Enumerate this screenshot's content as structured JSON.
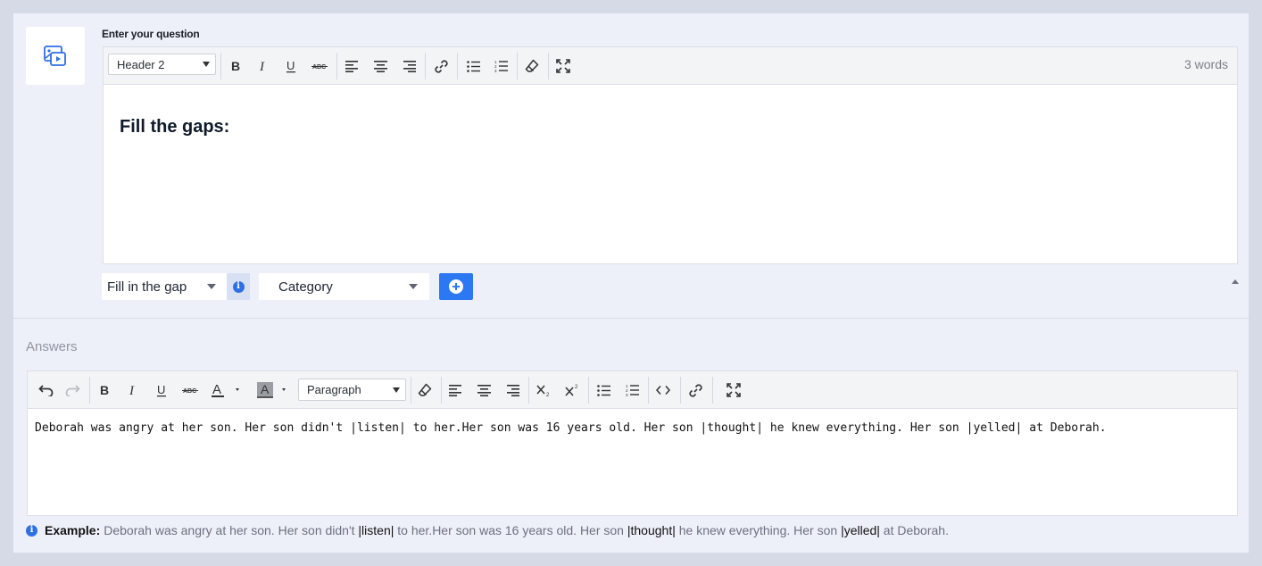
{
  "question": {
    "label": "Enter your question",
    "editor": {
      "block_format": "Header 2",
      "word_count": "3 words",
      "content": "Fill the gaps:"
    },
    "type_select": "Fill in the gap",
    "category_select": "Category"
  },
  "answers": {
    "label": "Answers",
    "editor": {
      "block_format": "Paragraph",
      "content": "Deborah was angry at her son. Her son didn't |listen| to her.Her son was 16 years old. Her son |thought| he knew everything. Her son |yelled| at Deborah."
    },
    "example": {
      "label": "Example:",
      "parts": [
        "Deborah was angry at her son. Her son didn't ",
        "|listen|",
        " to her.Her son was 16 years old. Her son ",
        "|thought|",
        " he knew everything. Her son ",
        "|yelled|",
        " at Deborah."
      ]
    }
  },
  "colors": {
    "accent": "#2c78f2",
    "page_bg": "#d6dae6",
    "card_bg": "#eef0f9"
  }
}
